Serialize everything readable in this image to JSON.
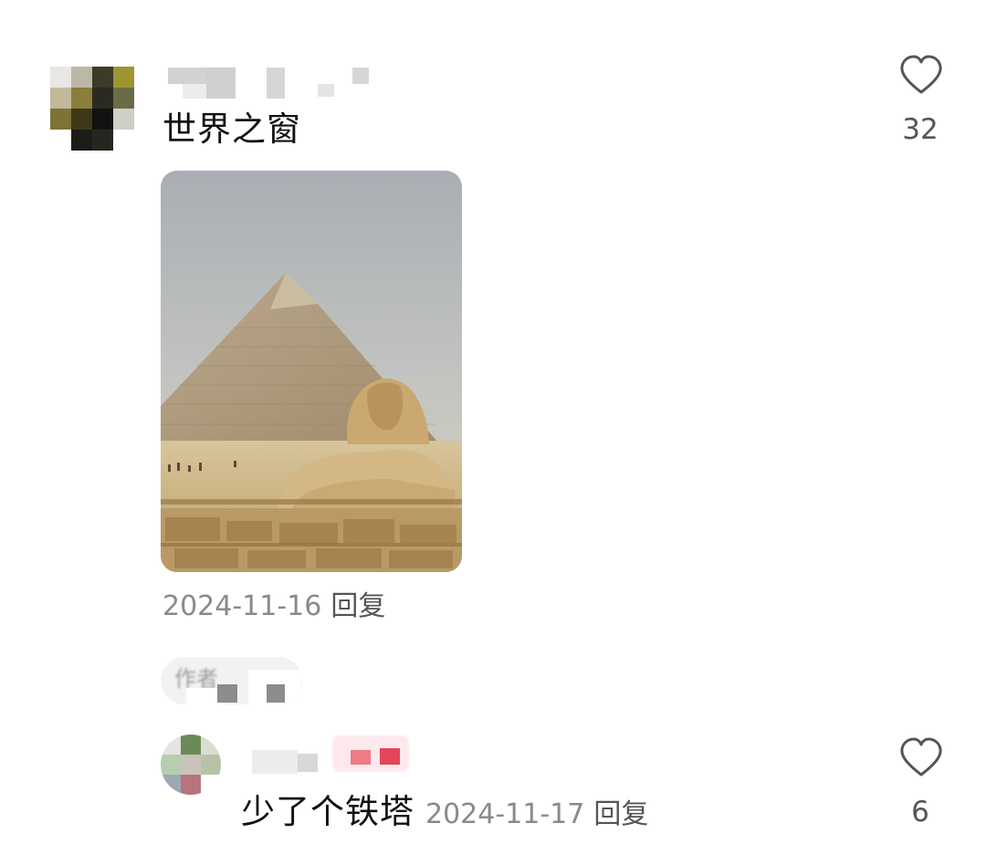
{
  "comments": [
    {
      "avatar_icon": "pixelated-avatar",
      "username_redacted": true,
      "text": "世界之窗",
      "like_icon": "heart-outline-icon",
      "like_count": "32",
      "image_subject": "pyramid-and-sphinx-photo",
      "date": "2024-11-16",
      "reply_label": "回复"
    },
    {
      "author_tag_label": "作者",
      "avatar_icon": "pixelated-avatar",
      "username_redacted": true,
      "text": "少了个铁塔",
      "like_icon": "heart-outline-icon",
      "like_count": "6",
      "date": "2024-11-17",
      "reply_label": "回复"
    }
  ],
  "colors": {
    "primary_text": "#111111",
    "secondary_text": "#8a8a8a",
    "reply_text": "#555555",
    "like_icon": "#555555",
    "tag_background": "#f2f2f2",
    "badge_background": "#fde9ec"
  }
}
